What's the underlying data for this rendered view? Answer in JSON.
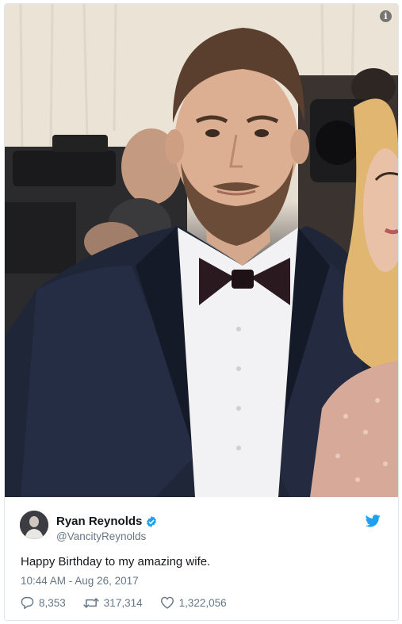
{
  "tweet": {
    "display_name": "Ryan Reynolds",
    "handle": "@VancityReynolds",
    "text": "Happy Birthday to my amazing wife.",
    "timestamp": "10:44 AM - Aug 26, 2017",
    "replies": "8,353",
    "retweets": "317,314",
    "likes": "1,322,056"
  },
  "icons": {
    "info": "info-icon",
    "verified": "verified-badge-icon",
    "brand": "twitter-bird-icon",
    "reply": "reply-bubble-icon",
    "retweet": "retweet-icon",
    "like": "heart-icon"
  },
  "colors": {
    "twitter_blue": "#1da1f2",
    "secondary_text": "#657786",
    "primary_text": "#14171a",
    "border": "#e1e8ed"
  }
}
